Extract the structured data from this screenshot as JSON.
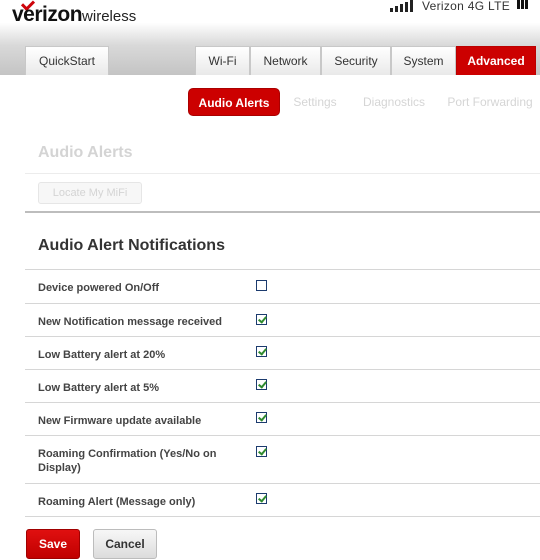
{
  "brand": {
    "name": "verizon",
    "suffix": "wireless",
    "accent": "#cc0000"
  },
  "status": {
    "network": "Verizon 4G LTE",
    "signal_icon": "signal-bars-icon",
    "battery_icon": "battery-icon"
  },
  "tabs": [
    {
      "label": "QuickStart",
      "active": false
    },
    {
      "label": "Wi-Fi",
      "active": false
    },
    {
      "label": "Network",
      "active": false
    },
    {
      "label": "Security",
      "active": false
    },
    {
      "label": "System",
      "active": false
    },
    {
      "label": "Advanced",
      "active": true
    }
  ],
  "subtabs": [
    {
      "label": "Audio Alerts",
      "active": true
    },
    {
      "label": "Settings",
      "active": false
    },
    {
      "label": "Diagnostics",
      "active": false
    },
    {
      "label": "Port Forwarding",
      "active": false
    }
  ],
  "faded_section": {
    "title": "Audio Alerts",
    "button_label": "Locate My MiFi"
  },
  "notifications": {
    "title": "Audio Alert Notifications",
    "rows": [
      {
        "label": "Device powered On/Off",
        "checked": false
      },
      {
        "label": "New Notification message received",
        "checked": true
      },
      {
        "label": "Low Battery alert at 20%",
        "checked": true
      },
      {
        "label": "Low Battery alert at 5%",
        "checked": true
      },
      {
        "label": "New Firmware update available",
        "checked": true
      },
      {
        "label": "Roaming Confirmation (Yes/No on Display)",
        "checked": true
      },
      {
        "label": "Roaming Alert (Message only)",
        "checked": true
      }
    ]
  },
  "actions": {
    "save_label": "Save",
    "cancel_label": "Cancel"
  }
}
